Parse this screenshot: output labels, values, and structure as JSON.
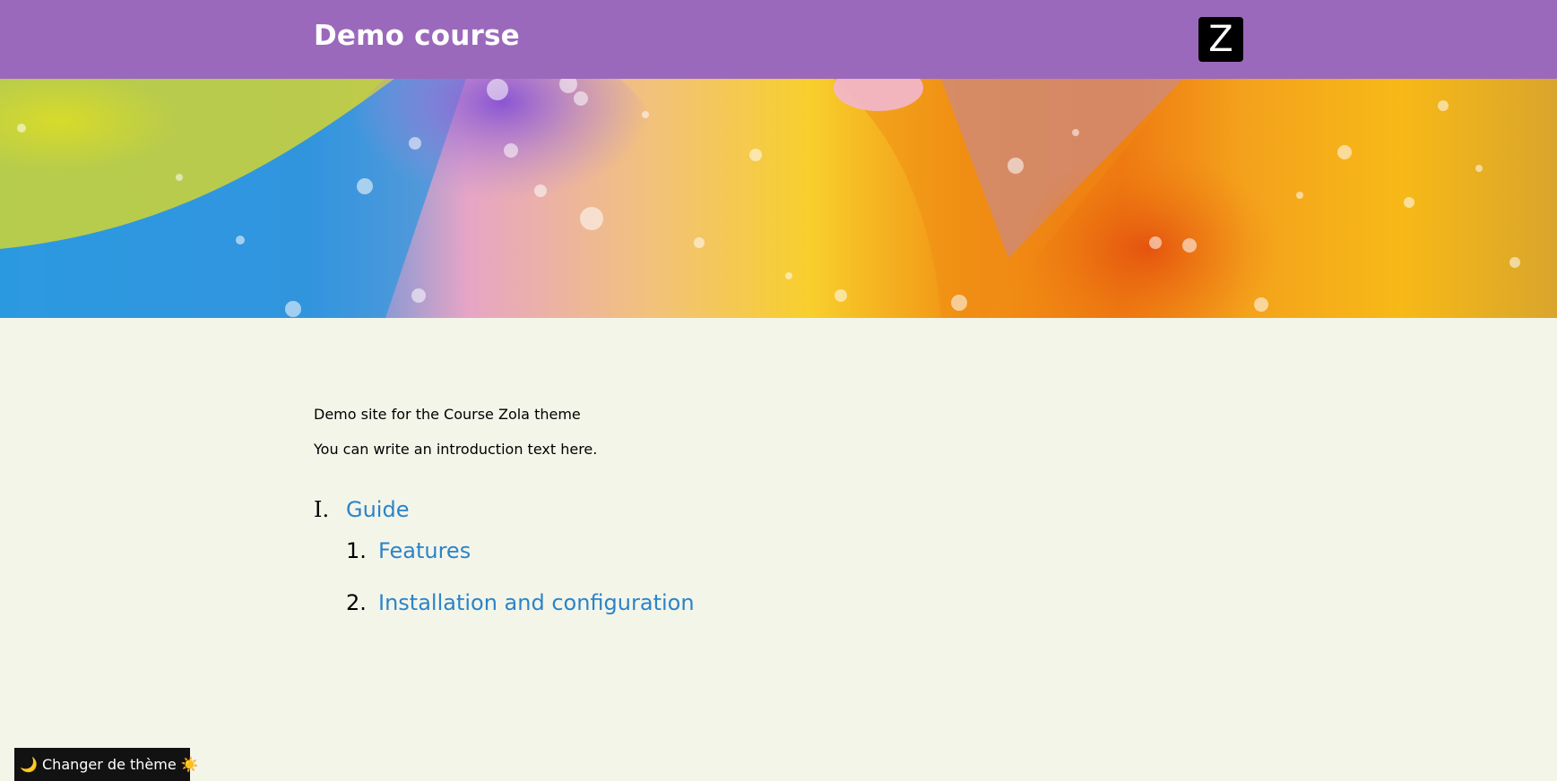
{
  "header": {
    "title": "Demo course",
    "logo_letter": "Z"
  },
  "banner": {
    "alt": "colorful oil bubbles banner"
  },
  "intro": {
    "line1": "Demo site for the Course Zola theme",
    "line2": "You can write an introduction text here."
  },
  "toc": {
    "chapters": [
      {
        "numeral": "I.",
        "label": "Guide",
        "sections": [
          {
            "number": "1.",
            "label": "Features"
          },
          {
            "number": "2.",
            "label": "Installation and configuration"
          }
        ]
      }
    ]
  },
  "theme_toggle": {
    "label": "🌙 Changer de thème ☀️"
  },
  "colors": {
    "header_bg": "#9b69bb",
    "page_bg": "#f4f5e9",
    "link": "#2a84c9"
  }
}
